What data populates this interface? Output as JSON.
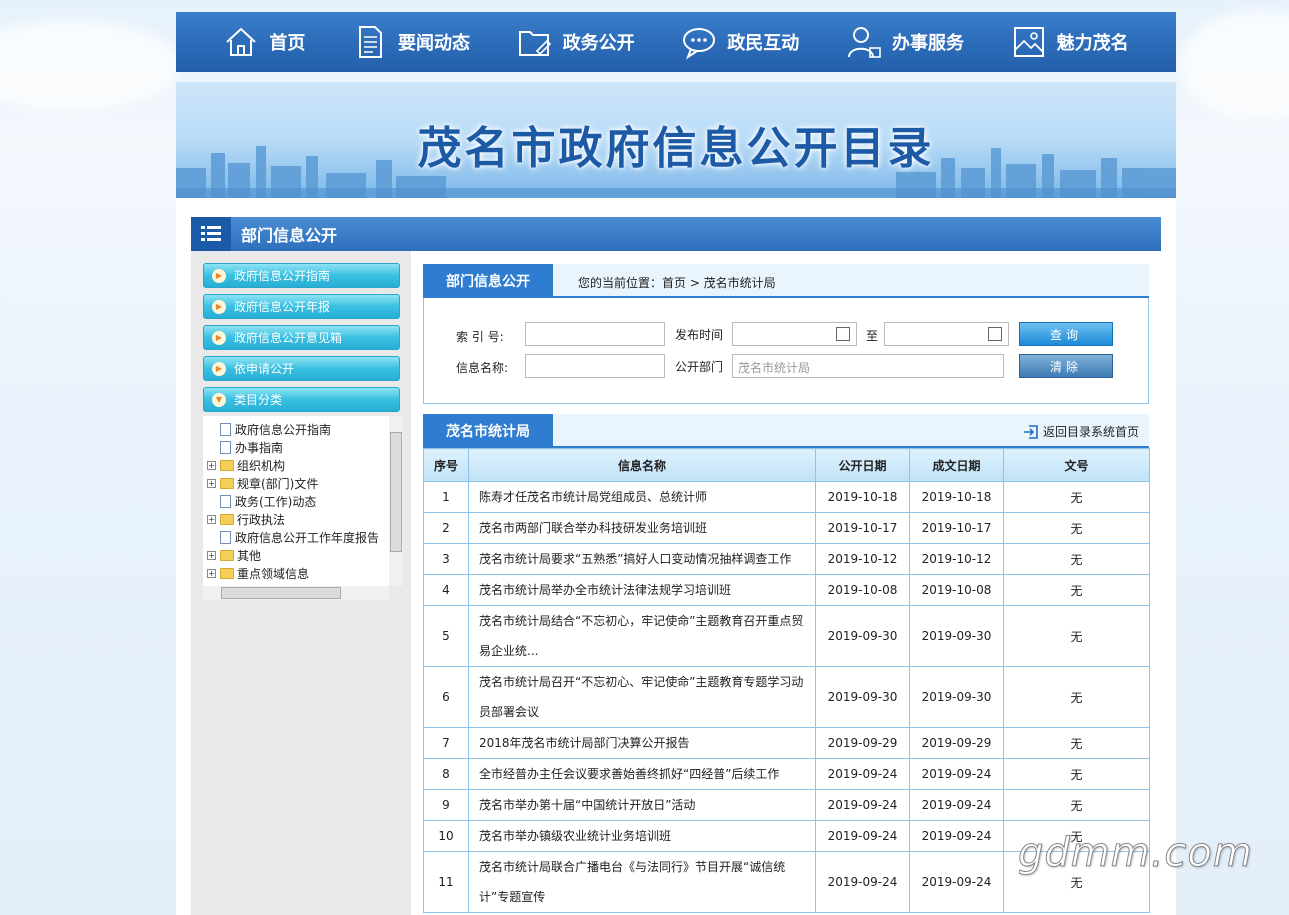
{
  "nav": {
    "items": [
      {
        "label": "首页",
        "icon": "home-icon"
      },
      {
        "label": "要闻动态",
        "icon": "document-icon"
      },
      {
        "label": "政务公开",
        "icon": "folder-icon"
      },
      {
        "label": "政民互动",
        "icon": "chat-icon"
      },
      {
        "label": "办事服务",
        "icon": "user-icon"
      },
      {
        "label": "魅力茂名",
        "icon": "picture-icon"
      }
    ]
  },
  "banner": {
    "title": "茂名市政府信息公开目录"
  },
  "section": {
    "title": "部门信息公开"
  },
  "sidebar": {
    "buttons": [
      {
        "label": "政府信息公开指南"
      },
      {
        "label": "政府信息公开年报"
      },
      {
        "label": "政府信息公开意见箱"
      },
      {
        "label": "依申请公开"
      },
      {
        "label": "类目分类"
      }
    ],
    "tree": [
      {
        "label": "政府信息公开指南",
        "type": "doc",
        "expand": ""
      },
      {
        "label": "办事指南",
        "type": "doc",
        "expand": ""
      },
      {
        "label": "组织机构",
        "type": "folder",
        "expand": "+"
      },
      {
        "label": "规章(部门)文件",
        "type": "folder",
        "expand": "+"
      },
      {
        "label": "政务(工作)动态",
        "type": "doc",
        "expand": ""
      },
      {
        "label": "行政执法",
        "type": "folder",
        "expand": "+"
      },
      {
        "label": "政府信息公开工作年度报告",
        "type": "doc",
        "expand": ""
      },
      {
        "label": "其他",
        "type": "folder",
        "expand": "+"
      },
      {
        "label": "重点领域信息",
        "type": "folder",
        "expand": "+"
      }
    ]
  },
  "search": {
    "tab": "部门信息公开",
    "crumb": "您的当前位置：首页 > 茂名市统计局",
    "index_label": "索 引 号:",
    "date_label": "发布时间",
    "to_label": "至",
    "name_label": "信息名称:",
    "dept_label": "公开部门",
    "dept_placeholder": "茂名市统计局",
    "query_btn": "查询",
    "clear_btn": "清除"
  },
  "list": {
    "tab": "茂名市统计局",
    "back": "返回目录系统首页",
    "headers": [
      "序号",
      "信息名称",
      "公开日期",
      "成文日期",
      "文号"
    ],
    "rows": [
      {
        "no": "1",
        "name": "陈寿才任茂名市统计局党组成员、总统计师",
        "pub": "2019-10-18",
        "wrote": "2019-10-18",
        "doc": "无"
      },
      {
        "no": "2",
        "name": "茂名市两部门联合举办科技研发业务培训班",
        "pub": "2019-10-17",
        "wrote": "2019-10-17",
        "doc": "无"
      },
      {
        "no": "3",
        "name": "茂名市统计局要求“五熟悉”搞好人口变动情况抽样调查工作",
        "pub": "2019-10-12",
        "wrote": "2019-10-12",
        "doc": "无"
      },
      {
        "no": "4",
        "name": "茂名市统计局举办全市统计法律法规学习培训班",
        "pub": "2019-10-08",
        "wrote": "2019-10-08",
        "doc": "无"
      },
      {
        "no": "5",
        "name": "茂名市统计局结合“不忘初心，牢记使命”主题教育召开重点贸易企业统...",
        "pub": "2019-09-30",
        "wrote": "2019-09-30",
        "doc": "无",
        "tall": true
      },
      {
        "no": "6",
        "name": "茂名市统计局召开“不忘初心、牢记使命”主题教育专题学习动员部署会议",
        "pub": "2019-09-30",
        "wrote": "2019-09-30",
        "doc": "无",
        "tall": true
      },
      {
        "no": "7",
        "name": "2018年茂名市统计局部门决算公开报告",
        "pub": "2019-09-29",
        "wrote": "2019-09-29",
        "doc": "无"
      },
      {
        "no": "8",
        "name": "全市经普办主任会议要求善始善终抓好“四经普”后续工作",
        "pub": "2019-09-24",
        "wrote": "2019-09-24",
        "doc": "无"
      },
      {
        "no": "9",
        "name": "茂名市举办第十届“中国统计开放日”活动",
        "pub": "2019-09-24",
        "wrote": "2019-09-24",
        "doc": "无"
      },
      {
        "no": "10",
        "name": "茂名市举办镇级农业统计业务培训班",
        "pub": "2019-09-24",
        "wrote": "2019-09-24",
        "doc": "无"
      },
      {
        "no": "11",
        "name": "茂名市统计局联合广播电台《与法同行》节目开展“诚信统计”专题宣传",
        "pub": "2019-09-24",
        "wrote": "2019-09-24",
        "doc": "无",
        "tall": true
      }
    ]
  },
  "watermark": "gdmm.com",
  "colors": {
    "nav_bg": "#2b6bb8",
    "accent": "#2e7dd0",
    "side_btn": "#39c0e1"
  }
}
